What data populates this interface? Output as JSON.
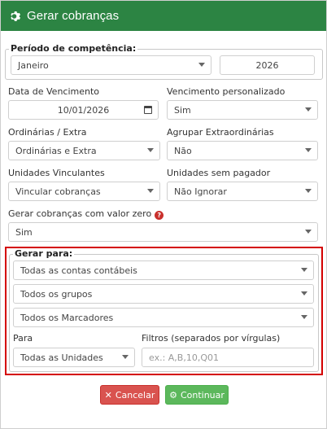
{
  "dialog": {
    "title": "Gerar cobranças"
  },
  "periodo": {
    "legend": "Período de competência:",
    "month": "Janeiro",
    "year": "2026"
  },
  "vencimento": {
    "label": "Data de Vencimento",
    "value": "10/01/2026"
  },
  "vencimento_personalizado": {
    "label": "Vencimento personalizado",
    "value": "Sim"
  },
  "ordinarias": {
    "label": "Ordinárias / Extra",
    "value": "Ordinárias e Extra"
  },
  "agrupar": {
    "label": "Agrupar Extraordinárias",
    "value": "Não"
  },
  "unidades_vinculantes": {
    "label": "Unidades Vinculantes",
    "value": "Vincular cobranças"
  },
  "unidades_sem_pagador": {
    "label": "Unidades sem pagador",
    "value": "Não Ignorar"
  },
  "valor_zero": {
    "label": "Gerar cobranças com valor zero",
    "help": "?",
    "value": "Sim"
  },
  "gerar_para": {
    "legend": "Gerar para:",
    "contas": "Todas as contas contábeis",
    "grupos": "Todos os grupos",
    "marcadores": "Todos os Marcadores",
    "para_label": "Para",
    "para_value": "Todas as Unidades",
    "filtros_label": "Filtros (separados por vírgulas)",
    "filtros_placeholder": "ex.: A,B,10,Q01"
  },
  "buttons": {
    "cancel": "Cancelar",
    "continue": "Continuar"
  },
  "colors": {
    "header": "#2c8443",
    "cancel": "#d9534f",
    "continue": "#5cb85c",
    "highlight": "#d40000"
  },
  "icons": {
    "header": "gear-icon",
    "cancel": "close-icon",
    "continue": "gear-icon",
    "date": "calendar-icon",
    "help": "question-icon"
  }
}
